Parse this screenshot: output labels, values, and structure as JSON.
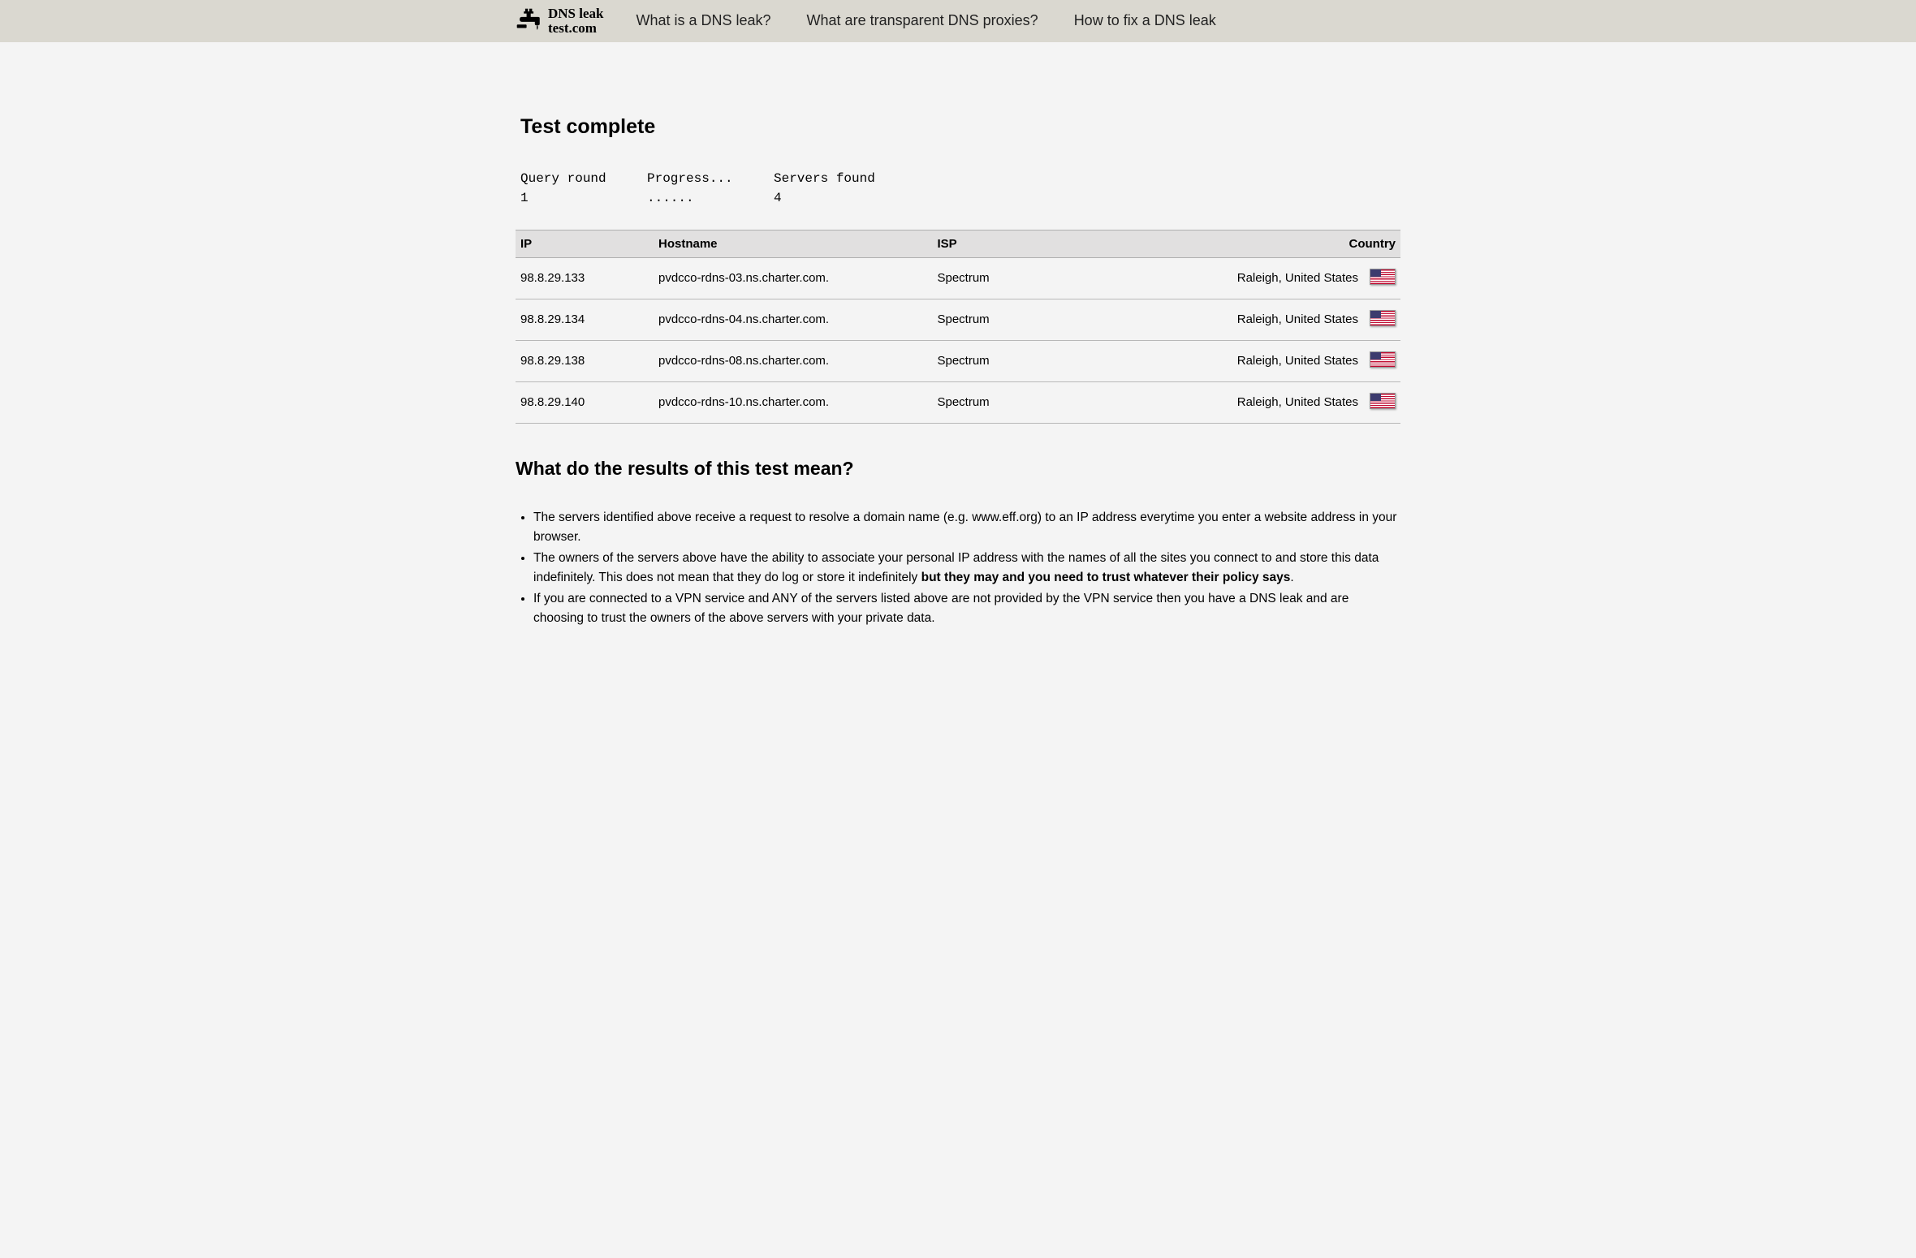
{
  "logo": {
    "line1": "DNS leak",
    "line2": "test.com"
  },
  "nav": {
    "what_is": "What is a DNS leak?",
    "transparent": "What are transparent DNS proxies?",
    "how_fix": "How to fix a DNS leak"
  },
  "page_title": "Test complete",
  "status": {
    "query_round_label": "Query round",
    "query_round_value": "1",
    "progress_label": "Progress...",
    "progress_value": "......",
    "servers_found_label": "Servers found",
    "servers_found_value": "4"
  },
  "table": {
    "headers": {
      "ip": "IP",
      "hostname": "Hostname",
      "isp": "ISP",
      "country": "Country"
    },
    "rows": [
      {
        "ip": "98.8.29.133",
        "hostname": "pvdcco-rdns-03.ns.charter.com.",
        "isp": "Spectrum",
        "country": "Raleigh, United States",
        "flag": "us"
      },
      {
        "ip": "98.8.29.134",
        "hostname": "pvdcco-rdns-04.ns.charter.com.",
        "isp": "Spectrum",
        "country": "Raleigh, United States",
        "flag": "us"
      },
      {
        "ip": "98.8.29.138",
        "hostname": "pvdcco-rdns-08.ns.charter.com.",
        "isp": "Spectrum",
        "country": "Raleigh, United States",
        "flag": "us"
      },
      {
        "ip": "98.8.29.140",
        "hostname": "pvdcco-rdns-10.ns.charter.com.",
        "isp": "Spectrum",
        "country": "Raleigh, United States",
        "flag": "us"
      }
    ]
  },
  "explain": {
    "title": "What do the results of this test mean?",
    "item1": "The servers identified above receive a request to resolve a domain name (e.g. www.eff.org) to an IP address everytime you enter a website address in your browser.",
    "item2a": "The owners of the servers above have the ability to associate your personal IP address with the names of all the sites you connect to and store this data indefinitely. This does not mean that they do log or store it indefinitely ",
    "item2bold": "but they may and you need to trust whatever their policy says",
    "item2b": ".",
    "item3": "If you are connected to a VPN service and ANY of the servers listed above are not provided by the VPN service then you have a DNS leak and are choosing to trust the owners of the above servers with your private data."
  }
}
